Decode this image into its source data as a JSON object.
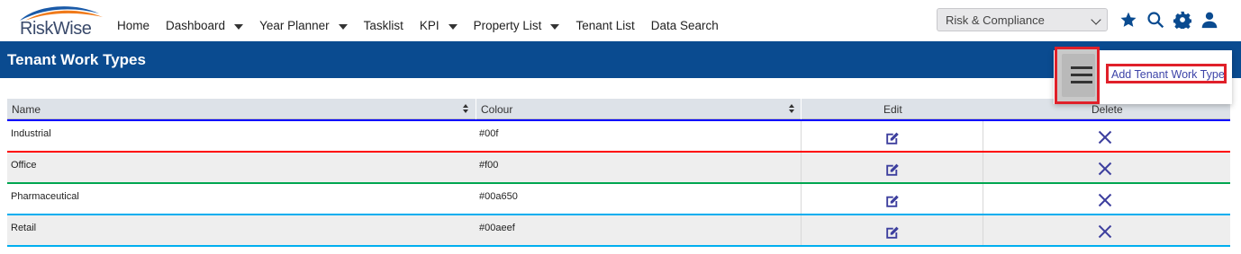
{
  "app": {
    "logo_text": "RiskWise",
    "brand_color": "#0a4b90"
  },
  "nav": {
    "items": [
      {
        "label": "Home",
        "dropdown": false
      },
      {
        "label": "Dashboard",
        "dropdown": true
      },
      {
        "label": "Year Planner",
        "dropdown": true
      },
      {
        "label": "Tasklist",
        "dropdown": false
      },
      {
        "label": "KPI",
        "dropdown": true
      },
      {
        "label": "Property List",
        "dropdown": true
      },
      {
        "label": "Tenant List",
        "dropdown": false
      },
      {
        "label": "Data Search",
        "dropdown": false
      }
    ],
    "module_select": "Risk & Compliance",
    "icons": [
      "star-icon",
      "search-icon",
      "gear-icon",
      "user-icon"
    ],
    "icon_color": "#0a4b90"
  },
  "page": {
    "title": "Tenant Work Types"
  },
  "menu": {
    "add_label": "Add Tenant Work Type"
  },
  "table": {
    "headers": {
      "name": "Name",
      "colour": "Colour",
      "edit": "Edit",
      "delete": "Delete"
    },
    "rows": [
      {
        "name": "Industrial",
        "colour": "#00f"
      },
      {
        "name": "Office",
        "colour": "#f00"
      },
      {
        "name": "Pharmaceutical",
        "colour": "#00a650"
      },
      {
        "name": "Retail",
        "colour": "#00aeef"
      }
    ],
    "action_icon_color": "#3d3f9e"
  }
}
